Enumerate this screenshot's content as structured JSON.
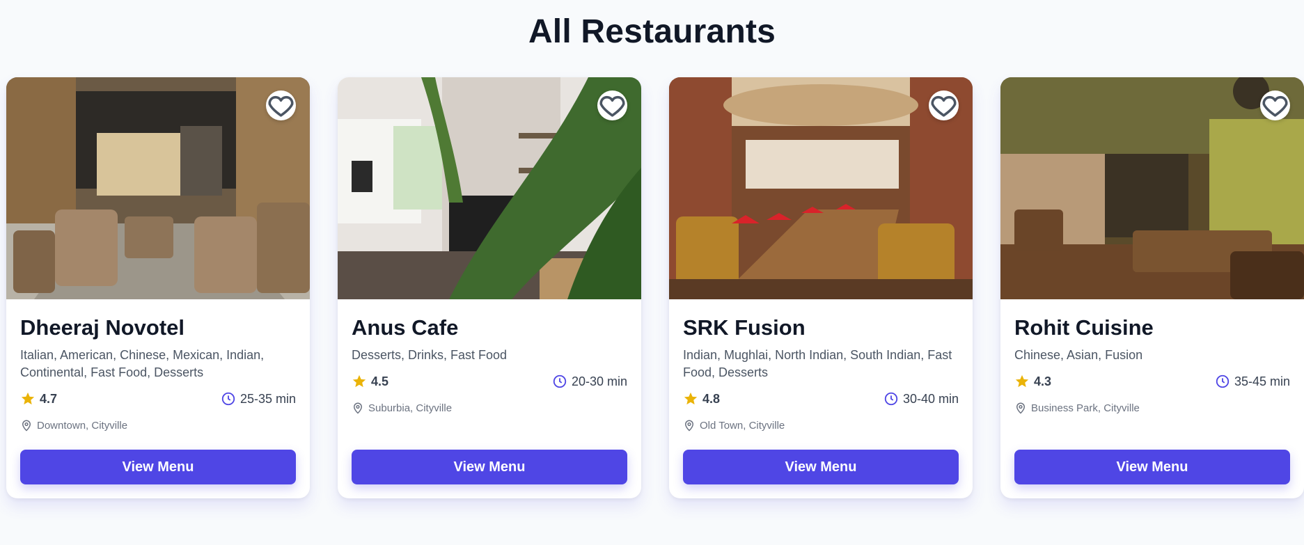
{
  "heading": "All Restaurants",
  "colors": {
    "accent": "#4f46e5",
    "star": "#eab308",
    "clock": "#4f46e5"
  },
  "icons": {
    "favorite": "heart-icon",
    "rating": "star-icon",
    "time": "clock-icon",
    "location": "map-pin-icon"
  },
  "restaurants": [
    {
      "name": "Dheeraj Novotel",
      "cuisines": "Italian, American, Chinese, Mexican, Indian, Continental, Fast Food, Desserts",
      "rating": "4.7",
      "time": "25-35 min",
      "location": "Downtown, Cityville",
      "button": "View Menu"
    },
    {
      "name": "Anus Cafe",
      "cuisines": "Desserts, Drinks, Fast Food",
      "rating": "4.5",
      "time": "20-30 min",
      "location": "Suburbia, Cityville",
      "button": "View Menu"
    },
    {
      "name": "SRK Fusion",
      "cuisines": "Indian, Mughlai, North Indian, South Indian, Fast Food, Desserts",
      "rating": "4.8",
      "time": "30-40 min",
      "location": "Old Town, Cityville",
      "button": "View Menu"
    },
    {
      "name": "Rohit Cuisine",
      "cuisines": "Chinese, Asian, Fusion",
      "rating": "4.3",
      "time": "35-45 min",
      "location": "Business Park, Cityville",
      "button": "View Menu"
    }
  ]
}
